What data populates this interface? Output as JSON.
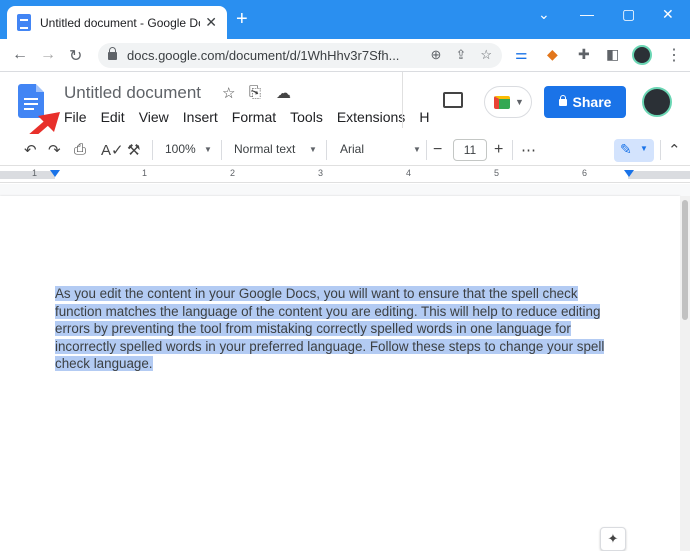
{
  "browser": {
    "tab_title": "Untitled document - Google Doc",
    "tab_close": "✕",
    "new_tab": "+",
    "url": "docs.google.com/document/d/1WhHhv3r7Sfh...",
    "window_controls": [
      "⌄",
      "—",
      "▢",
      "✕"
    ]
  },
  "docs": {
    "title": "Untitled document",
    "menu": [
      "File",
      "Edit",
      "View",
      "Insert",
      "Format",
      "Tools",
      "Extensions",
      "H"
    ],
    "share_label": "Share"
  },
  "toolbar": {
    "zoom": "100%",
    "style": "Normal text",
    "font": "Arial",
    "font_size": "11",
    "minus": "−",
    "plus": "+",
    "more": "⋯"
  },
  "ruler": {
    "numbers": [
      "1",
      "1",
      "2",
      "3",
      "4",
      "5",
      "6"
    ]
  },
  "document": {
    "paragraph": "As you edit the content in your Google Docs, you will want to ensure that the spell check function matches the language of the content you are editing. This will help to reduce editing errors by preventing the tool from mistaking correctly spelled words in one language for incorrectly spelled words in your preferred language. Follow these steps to change your spell check language. "
  },
  "colors": {
    "titlebar": "#2a8ff0",
    "share": "#1a73e8",
    "selection": "#b3cbf3",
    "annotation_arrow": "#e8302b"
  }
}
